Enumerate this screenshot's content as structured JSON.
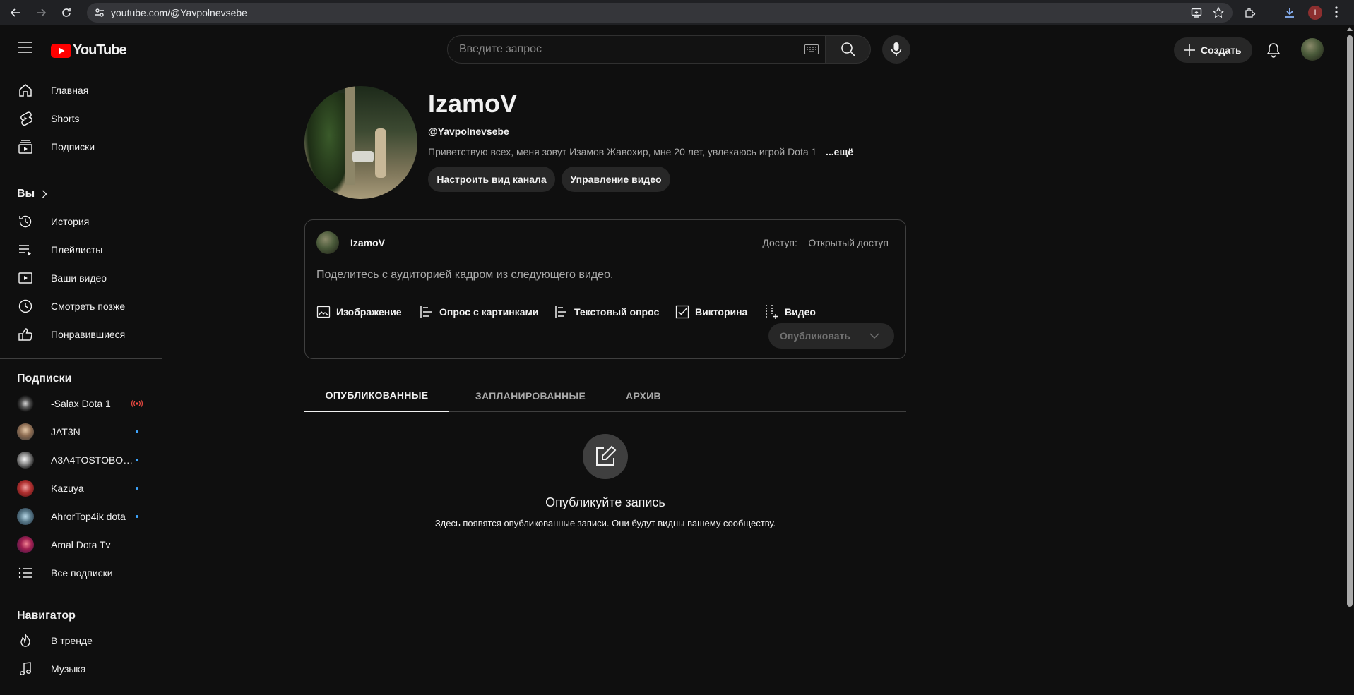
{
  "browser": {
    "url": "youtube.com/@Yavpolnevsebe",
    "profile_initial": "I"
  },
  "header": {
    "logo_text": "YouTube",
    "search_placeholder": "Введите запрос",
    "create_label": "Создать"
  },
  "sidebar": {
    "main": [
      {
        "label": "Главная",
        "icon": "home-icon"
      },
      {
        "label": "Shorts",
        "icon": "shorts-icon"
      },
      {
        "label": "Подписки",
        "icon": "subscriptions-icon"
      }
    ],
    "you_heading": "Вы",
    "you": [
      {
        "label": "История",
        "icon": "history-icon"
      },
      {
        "label": "Плейлисты",
        "icon": "playlists-icon"
      },
      {
        "label": "Ваши видео",
        "icon": "your-videos-icon"
      },
      {
        "label": "Смотреть позже",
        "icon": "watch-later-icon"
      },
      {
        "label": "Понравившиеся",
        "icon": "like-icon"
      }
    ],
    "subs_heading": "Подписки",
    "subs": [
      {
        "label": "-Salax Dota 1",
        "status": "live"
      },
      {
        "label": "JAT3N",
        "status": "new"
      },
      {
        "label": "A3A4TOSTOBOY...",
        "status": "new"
      },
      {
        "label": "Kazuya",
        "status": "new"
      },
      {
        "label": "AhrorTop4ik dota",
        "status": "new"
      },
      {
        "label": "Amal Dota Tv",
        "status": "none"
      }
    ],
    "all_subs_label": "Все подписки",
    "nav_heading": "Навигатор",
    "nav": [
      {
        "label": "В тренде",
        "icon": "trending-icon"
      },
      {
        "label": "Музыка",
        "icon": "music-icon"
      }
    ]
  },
  "channel": {
    "name": "IzamoV",
    "handle": "@Yavpolnevsebe",
    "description": "Приветствую всех, меня зовут Изамов Жавохир, мне 20 лет, увлекаюсь игрой Dota 1",
    "more_label": "...ещё",
    "customize_label": "Настроить вид канала",
    "manage_label": "Управление видео"
  },
  "post": {
    "author": "IzamoV",
    "access_label": "Доступ:",
    "access_value": "Открытый доступ",
    "prompt": "Поделитесь с аудиторией кадром из следующего видео.",
    "tools": [
      {
        "label": "Изображение",
        "icon": "image-icon"
      },
      {
        "label": "Опрос с картинками",
        "icon": "image-poll-icon"
      },
      {
        "label": "Текстовый опрос",
        "icon": "text-poll-icon"
      },
      {
        "label": "Викторина",
        "icon": "quiz-icon"
      },
      {
        "label": "Видео",
        "icon": "video-icon"
      }
    ],
    "publish_label": "Опубликовать"
  },
  "tabs": [
    {
      "label": "ОПУБЛИКОВАННЫЕ",
      "active": true
    },
    {
      "label": "ЗАПЛАНИРОВАННЫЕ",
      "active": false
    },
    {
      "label": "АРХИВ",
      "active": false
    }
  ],
  "empty": {
    "title": "Опубликуйте запись",
    "subtitle": "Здесь появятся опубликованные записи. Они будут видны вашему сообществу."
  },
  "colors": {
    "background": "#0f0f0f",
    "logo_red": "#ff0000",
    "live_red": "#ff4e45",
    "new_dot": "#3ea6ff"
  }
}
